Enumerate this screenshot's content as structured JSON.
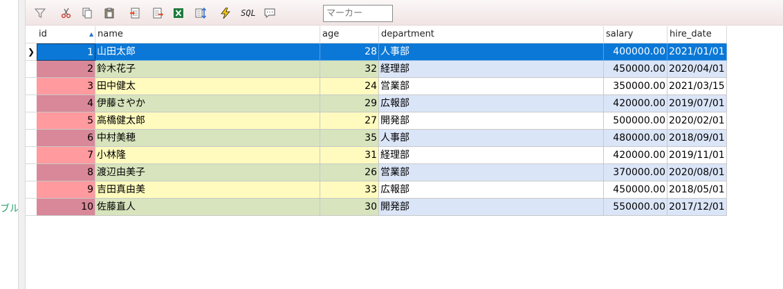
{
  "left_panel": {
    "label": "ブル"
  },
  "toolbar": {
    "buttons": [
      {
        "name": "filter-icon"
      },
      {
        "name": "scissors-icon"
      },
      {
        "name": "copy-icon"
      },
      {
        "name": "paste-icon"
      },
      {
        "name": "import-icon"
      },
      {
        "name": "export-icon"
      },
      {
        "name": "excel-icon"
      },
      {
        "name": "sort-icon"
      },
      {
        "name": "lightning-icon"
      },
      {
        "name": "sql-icon",
        "label": "SQL"
      },
      {
        "name": "comment-icon"
      }
    ],
    "marker_placeholder": "マーカー"
  },
  "table": {
    "columns": [
      "id",
      "name",
      "age",
      "department",
      "salary",
      "hire_date"
    ],
    "rows": [
      {
        "id": "1",
        "name": "山田太郎",
        "age": "28",
        "department": "人事部",
        "salary": "400000.00",
        "hire_date": "2021/01/01"
      },
      {
        "id": "2",
        "name": "鈴木花子",
        "age": "32",
        "department": "経理部",
        "salary": "450000.00",
        "hire_date": "2020/04/01"
      },
      {
        "id": "3",
        "name": "田中健太",
        "age": "24",
        "department": "営業部",
        "salary": "350000.00",
        "hire_date": "2021/03/15"
      },
      {
        "id": "4",
        "name": "伊藤さやか",
        "age": "29",
        "department": "広報部",
        "salary": "420000.00",
        "hire_date": "2019/07/01"
      },
      {
        "id": "5",
        "name": "高橋健太郎",
        "age": "27",
        "department": "開発部",
        "salary": "500000.00",
        "hire_date": "2020/02/01"
      },
      {
        "id": "6",
        "name": "中村美穂",
        "age": "35",
        "department": "人事部",
        "salary": "480000.00",
        "hire_date": "2018/09/01"
      },
      {
        "id": "7",
        "name": "小林隆",
        "age": "31",
        "department": "経理部",
        "salary": "420000.00",
        "hire_date": "2019/11/01"
      },
      {
        "id": "8",
        "name": "渡辺由美子",
        "age": "26",
        "department": "営業部",
        "salary": "370000.00",
        "hire_date": "2020/08/01"
      },
      {
        "id": "9",
        "name": "吉田真由美",
        "age": "33",
        "department": "広報部",
        "salary": "450000.00",
        "hire_date": "2018/05/01"
      },
      {
        "id": "10",
        "name": "佐藤直人",
        "age": "30",
        "department": "開発部",
        "salary": "550000.00",
        "hire_date": "2017/12/01"
      }
    ],
    "selected_row": 0,
    "sort_column": "id",
    "colors": {
      "selection": "#0b78d7",
      "id_even": "#d88898",
      "id_odd": "#ff9a9f",
      "band_green": "#d7e4bd",
      "band_yellow": "#fffbbe",
      "band_blue": "#dbe5f8",
      "band_white": "#ffffff"
    }
  }
}
